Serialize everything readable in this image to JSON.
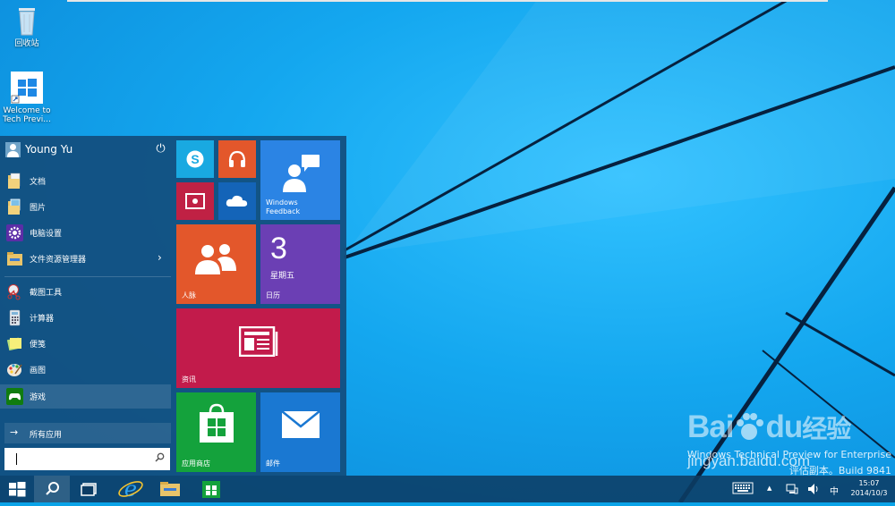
{
  "desktop": {
    "icons": [
      {
        "name": "recycle-bin",
        "label": "回收站"
      },
      {
        "name": "welcome",
        "label_line1": "Welcome to",
        "label_line2": "Tech Previ..."
      }
    ],
    "watermark": {
      "logo_text": "Bai",
      "logo_text2": "du",
      "logo_text3": "经验",
      "url": "jingyan.baidu.com"
    },
    "build_line1": "Windows Technical Preview for Enterprise",
    "build_line2": "评估副本。Build 9841"
  },
  "start_menu": {
    "user_name": "Young Yu",
    "power_symbol": "⏻",
    "places": [
      {
        "label": "文档"
      },
      {
        "label": "图片"
      },
      {
        "label": "电脑设置"
      },
      {
        "label": "文件资源管理器",
        "chevron": "›"
      }
    ],
    "apps": [
      {
        "label": "截图工具"
      },
      {
        "label": "计算器"
      },
      {
        "label": "便笺"
      },
      {
        "label": "画图"
      },
      {
        "label": "游戏"
      }
    ],
    "all_apps_label": "所有应用",
    "all_apps_arrow": "→",
    "search": {
      "value": "",
      "placeholder": ""
    },
    "tiles": {
      "feedback_line1": "Windows",
      "feedback_line2": "Feedback",
      "people": "人脉",
      "calendar_day": "3",
      "calendar_weekday": "星期五",
      "calendar": "日历",
      "news": "资讯",
      "store": "应用商店",
      "mail": "邮件"
    }
  },
  "taskbar": {
    "ime": "中",
    "tray_arrow": "▲",
    "time": "15:07",
    "date": "2014/10/3"
  },
  "colors": {
    "desktop": "#14a7ef",
    "start_menu": "#124e7d",
    "skype": "#19a9e1",
    "music": "#e3572b",
    "video": "#c02144",
    "onedrive": "#1464b8",
    "feedback": "#2b84e4",
    "people": "#e3572b",
    "calendar": "#6b3fb4",
    "news": "#c21b4b",
    "store": "#14a23c",
    "mail": "#1a78d2"
  }
}
